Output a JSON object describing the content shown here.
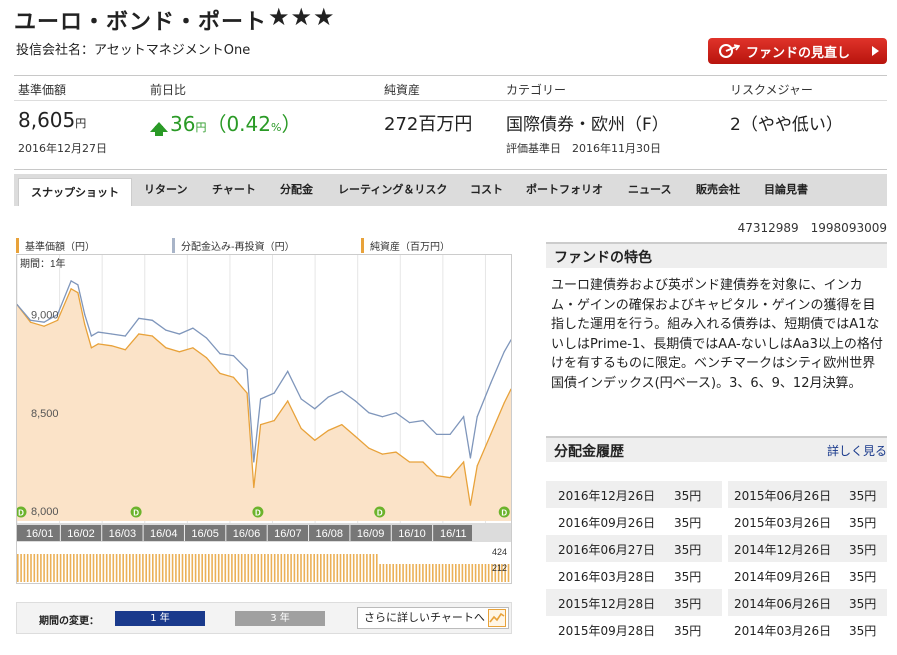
{
  "fund": {
    "title": "ユーロ・ボンド・ポート",
    "stars": "★★★",
    "company_label": "投信会社名：アセットマネジメントOne",
    "review_button": "ファンドの見直し"
  },
  "metrics": {
    "nav": {
      "label": "基準価額",
      "value": "8,605",
      "unit": "円",
      "date": "2016年12月27日"
    },
    "change": {
      "label": "前日比",
      "value": "36",
      "unit": "円",
      "pct_open": "（0.42",
      "pct_unit": "%",
      "pct_close": "）"
    },
    "assets": {
      "label": "純資産",
      "value": "272百万円"
    },
    "category": {
      "label": "カテゴリー",
      "value": "国際債券・欧州（F）",
      "sub": "評価基準日　2016年11月30日"
    },
    "risk": {
      "label": "リスクメジャー",
      "value": "2（やや低い）"
    }
  },
  "tabs": [
    "スナップショット",
    "リターン",
    "チャート",
    "分配金",
    "レーティング＆リスク",
    "コスト",
    "ポートフォリオ",
    "ニュース",
    "販売会社",
    "目論見書"
  ],
  "codes": [
    "47312989",
    "1998093009"
  ],
  "chart": {
    "legend": [
      "基準価額（円）",
      "分配金込み-再投資（円）",
      "純資産（百万円）"
    ],
    "period_text": "期間：1年",
    "volume_labels": [
      "424",
      "212"
    ],
    "distribution_marker": "D",
    "colors": {
      "line_orange": "#e8a23a",
      "line_gray": "#7f96bb",
      "fill": "#fbe3c8",
      "marker": "#6cb32c",
      "month_bar": "#777777"
    }
  },
  "chart_data": {
    "type": "line",
    "title": "",
    "xlabel": "",
    "ylabel": "",
    "ylim": [
      7950,
      9200
    ],
    "yticks": [
      9000,
      8500,
      8000
    ],
    "ytick_labels": [
      "9,000",
      "8,500",
      "8,000"
    ],
    "x_tick_labels": [
      "16/01",
      "16/02",
      "16/03",
      "16/04",
      "16/05",
      "16/06",
      "16/07",
      "16/08",
      "16/09",
      "16/10",
      "16/11"
    ],
    "x_range_days": [
      0,
      365
    ],
    "series": [
      {
        "name": "基準価額（円）",
        "color": "#e8a23a",
        "x": [
          0,
          10,
          20,
          30,
          40,
          45,
          50,
          55,
          60,
          70,
          80,
          90,
          100,
          110,
          120,
          130,
          140,
          150,
          160,
          170,
          175,
          180,
          190,
          200,
          210,
          220,
          230,
          240,
          250,
          260,
          270,
          280,
          290,
          300,
          310,
          320,
          330,
          335,
          340,
          350,
          360,
          365
        ],
        "y": [
          9050,
          8960,
          8940,
          8970,
          9130,
          9110,
          8950,
          8830,
          8850,
          8840,
          8820,
          8900,
          8890,
          8830,
          8810,
          8830,
          8780,
          8700,
          8680,
          8600,
          8120,
          8440,
          8460,
          8560,
          8420,
          8360,
          8410,
          8440,
          8380,
          8320,
          8290,
          8300,
          8250,
          8250,
          8180,
          8170,
          8250,
          8030,
          8230,
          8390,
          8550,
          8620
        ]
      },
      {
        "name": "分配金込み-再投資（円）",
        "color": "#7f96bb",
        "x": [
          0,
          10,
          20,
          30,
          40,
          45,
          50,
          55,
          60,
          70,
          80,
          90,
          100,
          110,
          120,
          130,
          140,
          150,
          160,
          170,
          175,
          180,
          190,
          200,
          210,
          220,
          230,
          240,
          250,
          260,
          270,
          280,
          290,
          300,
          310,
          320,
          330,
          335,
          340,
          350,
          360,
          365
        ],
        "y": [
          9050,
          8970,
          8960,
          9000,
          9170,
          9150,
          9000,
          8890,
          8910,
          8900,
          8890,
          8980,
          8970,
          8920,
          8900,
          8930,
          8880,
          8800,
          8790,
          8720,
          8250,
          8570,
          8600,
          8710,
          8570,
          8520,
          8580,
          8610,
          8560,
          8500,
          8480,
          8500,
          8450,
          8460,
          8390,
          8390,
          8480,
          8270,
          8480,
          8650,
          8810,
          8870
        ]
      }
    ],
    "distribution_days": [
      0,
      88,
      178,
      268,
      360
    ],
    "volume_series": {
      "name": "純資産（百万円）",
      "values_million_yen": [
        272
      ]
    }
  },
  "feature": {
    "heading": "ファンドの特色",
    "text": "ユーロ建債券および英ポンド建債券を対象に、インカム・ゲインの確保およびキャピタル・ゲインの獲得を目指した運用を行う。組み入れる債券は、短期債ではA1ないしはPrime-1、長期債ではAA-ないしはAa3以上の格付けを有するものに限定。ベンチマークはシティ欧州世界国債インデックス(円ベース)。3、6、9、12月決算。"
  },
  "distribution": {
    "heading": "分配金履歴",
    "more_link": "詳しく見る",
    "left": [
      {
        "date": "2016年12月26日",
        "amount": "35円"
      },
      {
        "date": "2016年09月26日",
        "amount": "35円"
      },
      {
        "date": "2016年06月27日",
        "amount": "35円"
      },
      {
        "date": "2016年03月28日",
        "amount": "35円"
      },
      {
        "date": "2015年12月28日",
        "amount": "35円"
      },
      {
        "date": "2015年09月28日",
        "amount": "35円"
      }
    ],
    "right": [
      {
        "date": "2015年06月26日",
        "amount": "35円"
      },
      {
        "date": "2015年03月26日",
        "amount": "35円"
      },
      {
        "date": "2014年12月26日",
        "amount": "35円"
      },
      {
        "date": "2014年09月26日",
        "amount": "35円"
      },
      {
        "date": "2014年06月26日",
        "amount": "35円"
      },
      {
        "date": "2014年03月26日",
        "amount": "35円"
      }
    ]
  },
  "period_control": {
    "label": "期間の変更：",
    "selected": "1 年",
    "other": "3 年",
    "more_chart": "さらに詳しいチャートへ"
  }
}
